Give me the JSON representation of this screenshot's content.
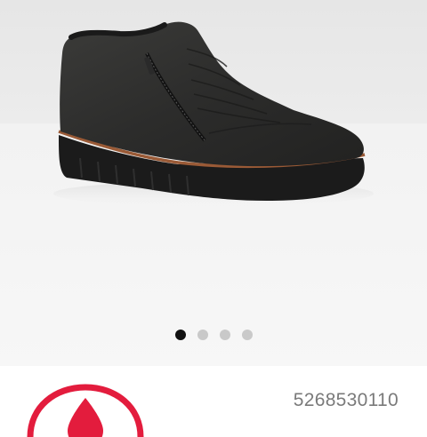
{
  "product": {
    "image_icon": "ankle-boot-image",
    "sku": "5268530110"
  },
  "gallery": {
    "image_count": 4,
    "active_index": 0
  },
  "brand": {
    "logo_icon": "brand-drop-logo",
    "logo_color": "#e31c3d"
  },
  "colors": {
    "dot_active": "#111111",
    "dot_inactive": "#c9c9c9",
    "sku_text": "#7a7a7a"
  }
}
